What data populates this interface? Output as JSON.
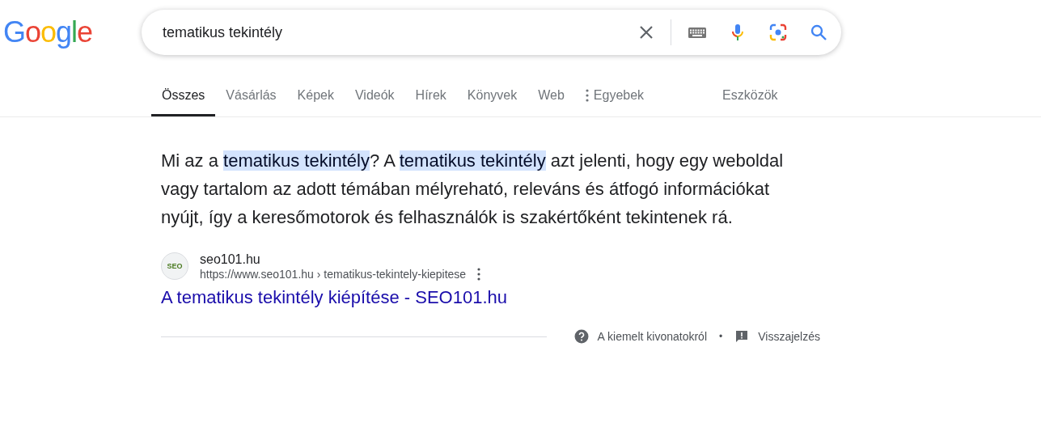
{
  "logo": "Google",
  "search": {
    "value": "tematikus tekintély"
  },
  "tabs": [
    {
      "label": "Összes",
      "selected": true
    },
    {
      "label": "Vásárlás",
      "selected": false
    },
    {
      "label": "Képek",
      "selected": false
    },
    {
      "label": "Videók",
      "selected": false
    },
    {
      "label": "Hírek",
      "selected": false
    },
    {
      "label": "Könyvek",
      "selected": false
    },
    {
      "label": "Web",
      "selected": false
    },
    {
      "label": "Egyebek",
      "selected": false,
      "kind": "more"
    }
  ],
  "tools": "Eszközök",
  "snippet": {
    "text": "Mi az a **tematikus tekintély**? A **tematikus tekintély** azt jelenti, hogy egy weboldal vagy tartalom az adott témában mélyreható, releváns és átfogó információkat nyújt, így a keresőmotorok és felhasználók is szakértőként tekintenek rá.",
    "favicon_text": "SEO",
    "site": "seo101.hu",
    "url": "https://www.seo101.hu › tematikus-tekintely-kiepitese",
    "title": "A tematikus tekintély kiépítése - SEO101.hu"
  },
  "footer": {
    "about": "A kiemelt kivonatokról",
    "separator": "•",
    "feedback": "Visszajelzés"
  }
}
